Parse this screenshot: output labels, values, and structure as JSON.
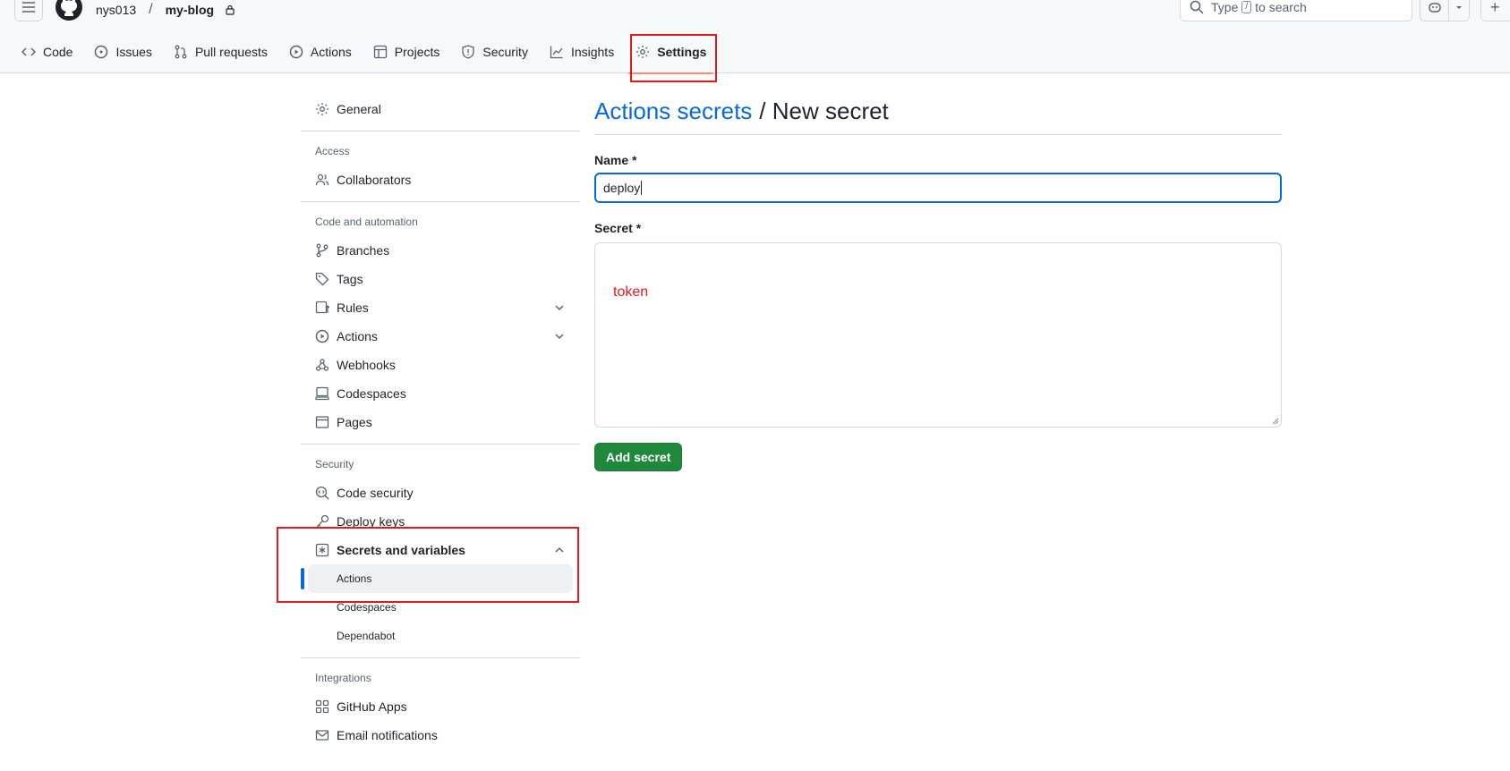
{
  "header": {
    "owner": "nys013",
    "separator": "/",
    "repo": "my-blog",
    "search_prefix": "Type",
    "search_key": "/",
    "search_suffix": "to search",
    "plus": "+"
  },
  "tabs": [
    {
      "label": "Code",
      "icon": "code-icon"
    },
    {
      "label": "Issues",
      "icon": "issue-icon"
    },
    {
      "label": "Pull requests",
      "icon": "pull-request-icon"
    },
    {
      "label": "Actions",
      "icon": "play-icon"
    },
    {
      "label": "Projects",
      "icon": "table-icon"
    },
    {
      "label": "Security",
      "icon": "shield-icon"
    },
    {
      "label": "Insights",
      "icon": "graph-icon"
    },
    {
      "label": "Settings",
      "icon": "gear-icon",
      "selected": true
    }
  ],
  "sidebar": {
    "general": "General",
    "access_title": "Access",
    "collaborators": "Collaborators",
    "code_automation_title": "Code and automation",
    "branches": "Branches",
    "tags": "Tags",
    "rules": "Rules",
    "actions": "Actions",
    "webhooks": "Webhooks",
    "codespaces": "Codespaces",
    "pages": "Pages",
    "security_title": "Security",
    "code_security": "Code security",
    "deploy_keys": "Deploy keys",
    "secrets_variables": "Secrets and variables",
    "sub_actions": "Actions",
    "sub_codespaces": "Codespaces",
    "sub_dependabot": "Dependabot",
    "integrations_title": "Integrations",
    "github_apps": "GitHub Apps",
    "email_notifications": "Email notifications"
  },
  "main": {
    "title_link": "Actions secrets",
    "title_rest": "/ New secret",
    "name_label": "Name *",
    "name_value": "deploy",
    "secret_label": "Secret *",
    "secret_value": "token",
    "add_button": "Add secret"
  },
  "colors": {
    "accent": "#0969da",
    "primary_button": "#1f883d",
    "annotation": "#e5191c",
    "tab_underline": "#fd8c73"
  }
}
